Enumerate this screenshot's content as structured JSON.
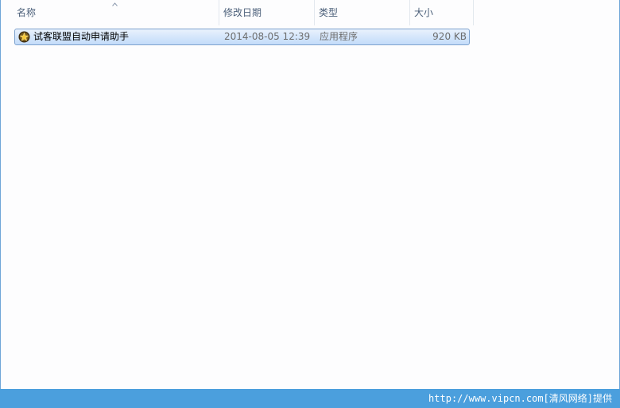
{
  "columns": {
    "name": "名称",
    "date": "修改日期",
    "type": "类型",
    "size": "大小"
  },
  "sort": {
    "column": "name",
    "direction": "ascending",
    "icon": "sort-ascending-icon"
  },
  "files": [
    {
      "name": "试客联盟自动申请助手",
      "date": "2014-08-05 12:39",
      "type": "应用程序",
      "size": "920 KB",
      "icon": "app-star-icon",
      "selected": true
    }
  ],
  "footer": {
    "watermark": "http://www.vipcn.com[清风网络]提供"
  },
  "colors": {
    "selection": "#cce1fb",
    "selection_border": "#7da2ce",
    "footer_bar": "#4b9fdd",
    "frame_border": "#6fa6d8"
  }
}
